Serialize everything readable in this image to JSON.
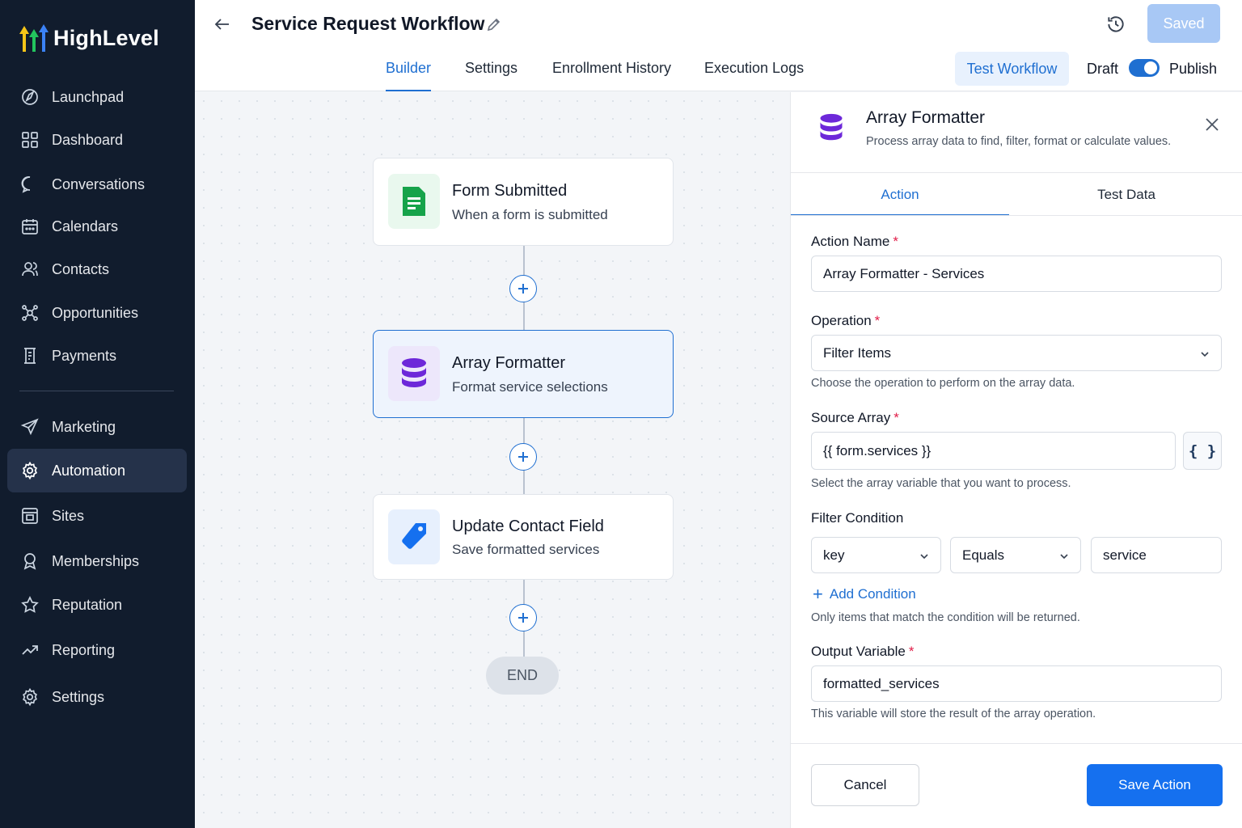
{
  "brand": {
    "name": "HighLevel"
  },
  "sidebar": {
    "items": [
      {
        "label": "Launchpad",
        "icon": "launchpad-icon"
      },
      {
        "label": "Dashboard",
        "icon": "dashboard-icon"
      },
      {
        "label": "Conversations",
        "icon": "chat-bubble-icon"
      },
      {
        "label": "Calendars",
        "icon": "calendar-icon"
      },
      {
        "label": "Contacts",
        "icon": "contacts-icon"
      },
      {
        "label": "Opportunities",
        "icon": "opportunities-icon"
      },
      {
        "label": "Payments",
        "icon": "payments-icon"
      },
      {
        "label": "Marketing",
        "icon": "paper-plane-icon"
      },
      {
        "label": "Automation",
        "icon": "gear-icon",
        "active": true
      },
      {
        "label": "Sites",
        "icon": "sites-icon"
      },
      {
        "label": "Memberships",
        "icon": "award-icon"
      },
      {
        "label": "Reputation",
        "icon": "star-icon"
      },
      {
        "label": "Reporting",
        "icon": "trend-icon"
      },
      {
        "label": "Settings",
        "icon": "settings-gear-icon"
      }
    ]
  },
  "header": {
    "title": "Service Request Workflow",
    "saved_label": "Saved",
    "tabs": [
      "Builder",
      "Settings",
      "Enrollment History",
      "Execution Logs"
    ],
    "active_tab": "Builder",
    "test_workflow_label": "Test Workflow",
    "draft_label": "Draft",
    "publish_label": "Publish",
    "publish_toggle_on": true
  },
  "workflow": {
    "nodes": [
      {
        "title": "Form Submitted",
        "subtitle": "When a form is submitted",
        "icon": "form-document-icon",
        "color": "#16a34a"
      },
      {
        "title": "Array Formatter",
        "subtitle": "Format service selections",
        "icon": "database-icon",
        "color": "#6d28d9",
        "selected": true
      },
      {
        "title": "Update Contact Field",
        "subtitle": "Save formatted services",
        "icon": "tag-icon",
        "color": "#1570ef"
      }
    ],
    "end_label": "END"
  },
  "panel": {
    "title": "Array Formatter",
    "description": "Process array data to find, filter, format or calculate values.",
    "tabs": [
      "Action",
      "Test Data"
    ],
    "active_tab": "Action",
    "action_name": {
      "label": "Action Name",
      "value": "Array Formatter - Services"
    },
    "operation": {
      "label": "Operation",
      "value": "Filter Items",
      "hint": "Choose the operation to perform on the array data."
    },
    "source_array": {
      "label": "Source Array",
      "value": "{{ form.services }}",
      "hint": "Select the array variable that you want to process.",
      "var_button": "{ }"
    },
    "filter_condition": {
      "label": "Filter Condition",
      "field": "key",
      "operator": "Equals",
      "value": "service",
      "add_label": "Add Condition",
      "hint": "Only items that match the condition will be returned."
    },
    "output_variable": {
      "label": "Output Variable",
      "value": "formatted_services",
      "hint": "This variable will store the result of the array operation."
    },
    "required_mark": "*",
    "cancel_label": "Cancel",
    "save_label": "Save Action"
  }
}
